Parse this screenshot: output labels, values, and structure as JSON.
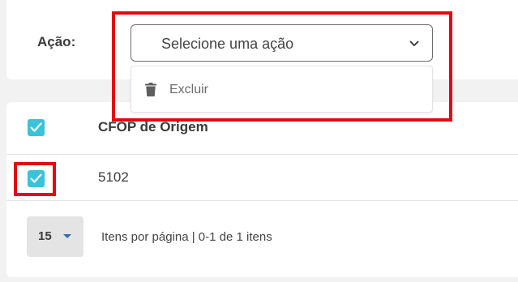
{
  "action_panel": {
    "label": "Ação:",
    "select_placeholder": "Selecione uma ação",
    "menu_items": [
      {
        "label": "Excluir",
        "icon": "trash-icon"
      }
    ]
  },
  "table": {
    "columns": [
      "CFOP de Origem"
    ],
    "rows": [
      {
        "cfop_origem": "5102",
        "checked": true
      }
    ],
    "header_checked": true
  },
  "pagination": {
    "page_size": "15",
    "summary": "Itens por página | 0-1 de 1 itens"
  },
  "colors": {
    "checkbox": "#37c4d9",
    "highlight": "#e30613",
    "caret": "#2a6fb0"
  }
}
